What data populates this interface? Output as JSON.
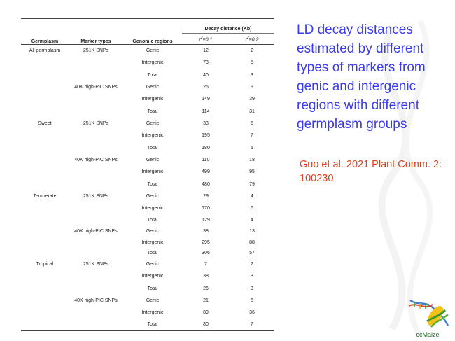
{
  "table": {
    "headers": {
      "germplasm": "Germplasm",
      "marker_types": "Marker types",
      "genomic_regions": "Genomic regions",
      "decay_distance": "Decay distance (Kb)",
      "r1_base": "r",
      "r1_exp": "2",
      "r1_val": "=0.1",
      "r2_base": "r",
      "r2_exp": "2",
      "r2_val": "=0.2"
    },
    "rows": [
      {
        "germplasm": "All germplasm",
        "marker": "251K SNPs",
        "region": "Genic",
        "r1": "12",
        "r2": "2"
      },
      {
        "germplasm": "",
        "marker": "",
        "region": "Intergenic",
        "r1": "73",
        "r2": "5"
      },
      {
        "germplasm": "",
        "marker": "",
        "region": "Total",
        "r1": "40",
        "r2": "3"
      },
      {
        "germplasm": "",
        "marker": "40K high-PIC SNPs",
        "region": "Genic",
        "r1": "26",
        "r2": "9"
      },
      {
        "germplasm": "",
        "marker": "",
        "region": "Intergenic",
        "r1": "149",
        "r2": "39"
      },
      {
        "germplasm": "",
        "marker": "",
        "region": "Total",
        "r1": "114",
        "r2": "31"
      },
      {
        "germplasm": "Sweet",
        "marker": "251K SNPs",
        "region": "Genic",
        "r1": "33",
        "r2": "5"
      },
      {
        "germplasm": "",
        "marker": "",
        "region": "Intergenic",
        "r1": "195",
        "r2": "7"
      },
      {
        "germplasm": "",
        "marker": "",
        "region": "Total",
        "r1": "180",
        "r2": "5"
      },
      {
        "germplasm": "",
        "marker": "40K high-PIC SNPs",
        "region": "Genic",
        "r1": "110",
        "r2": "18"
      },
      {
        "germplasm": "",
        "marker": "",
        "region": "Intergenic",
        "r1": "499",
        "r2": "95"
      },
      {
        "germplasm": "",
        "marker": "",
        "region": "Total",
        "r1": "480",
        "r2": "79"
      },
      {
        "germplasm": "Temperate",
        "marker": "251K SNPs",
        "region": "Genic",
        "r1": "29",
        "r2": "4"
      },
      {
        "germplasm": "",
        "marker": "",
        "region": "Intergenic",
        "r1": "170",
        "r2": "6"
      },
      {
        "germplasm": "",
        "marker": "",
        "region": "Total",
        "r1": "129",
        "r2": "4"
      },
      {
        "germplasm": "",
        "marker": "40K high-PIC SNPs",
        "region": "Genic",
        "r1": "38",
        "r2": "13"
      },
      {
        "germplasm": "",
        "marker": "",
        "region": "Intergenic",
        "r1": "295",
        "r2": "88"
      },
      {
        "germplasm": "",
        "marker": "",
        "region": "Total",
        "r1": "306",
        "r2": "57"
      },
      {
        "germplasm": "Tropical",
        "marker": "251K SNPs",
        "region": "Genic",
        "r1": "7",
        "r2": "2"
      },
      {
        "germplasm": "",
        "marker": "",
        "region": "Intergenic",
        "r1": "38",
        "r2": "3"
      },
      {
        "germplasm": "",
        "marker": "",
        "region": "Total",
        "r1": "26",
        "r2": "3"
      },
      {
        "germplasm": "",
        "marker": "40K high-PIC SNPs",
        "region": "Genic",
        "r1": "21",
        "r2": "5"
      },
      {
        "germplasm": "",
        "marker": "",
        "region": "Intergenic",
        "r1": "89",
        "r2": "36"
      },
      {
        "germplasm": "",
        "marker": "",
        "region": "Total",
        "r1": "80",
        "r2": "7"
      }
    ]
  },
  "title": "LD decay distances estimated by different types of markers from genic and intergenic regions with different germplasm groups",
  "citation": "Guo et al. 2021 Plant Comm. 2: 100230",
  "logo": {
    "text": "ccMaize",
    "icon": "maize-dna-logo-icon"
  },
  "colors": {
    "title": "#3a3af0",
    "citation": "#e0401a",
    "logo_text": "#2a6a2a"
  }
}
